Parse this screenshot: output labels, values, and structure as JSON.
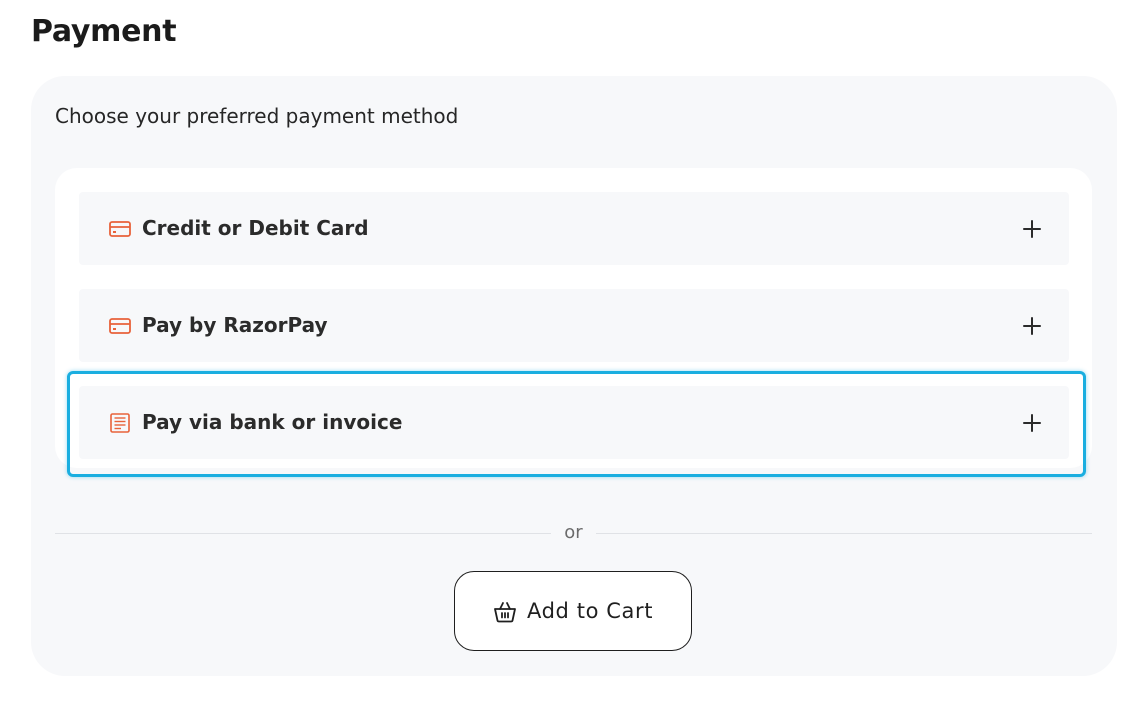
{
  "page": {
    "title": "Payment"
  },
  "panel": {
    "subtitle": "Choose your preferred payment method"
  },
  "methods": [
    {
      "label": "Credit or Debit Card",
      "icon": "credit-card-icon"
    },
    {
      "label": "Pay by RazorPay",
      "icon": "credit-card-icon"
    },
    {
      "label": "Pay via bank or invoice",
      "icon": "invoice-icon",
      "highlighted": true
    }
  ],
  "divider": {
    "text": "or"
  },
  "cart": {
    "label": "Add to Cart",
    "icon": "basket-icon"
  },
  "colors": {
    "accent_icon": "#e8623a",
    "highlight": "#1aaee0",
    "panel_bg": "#f7f8fa"
  }
}
